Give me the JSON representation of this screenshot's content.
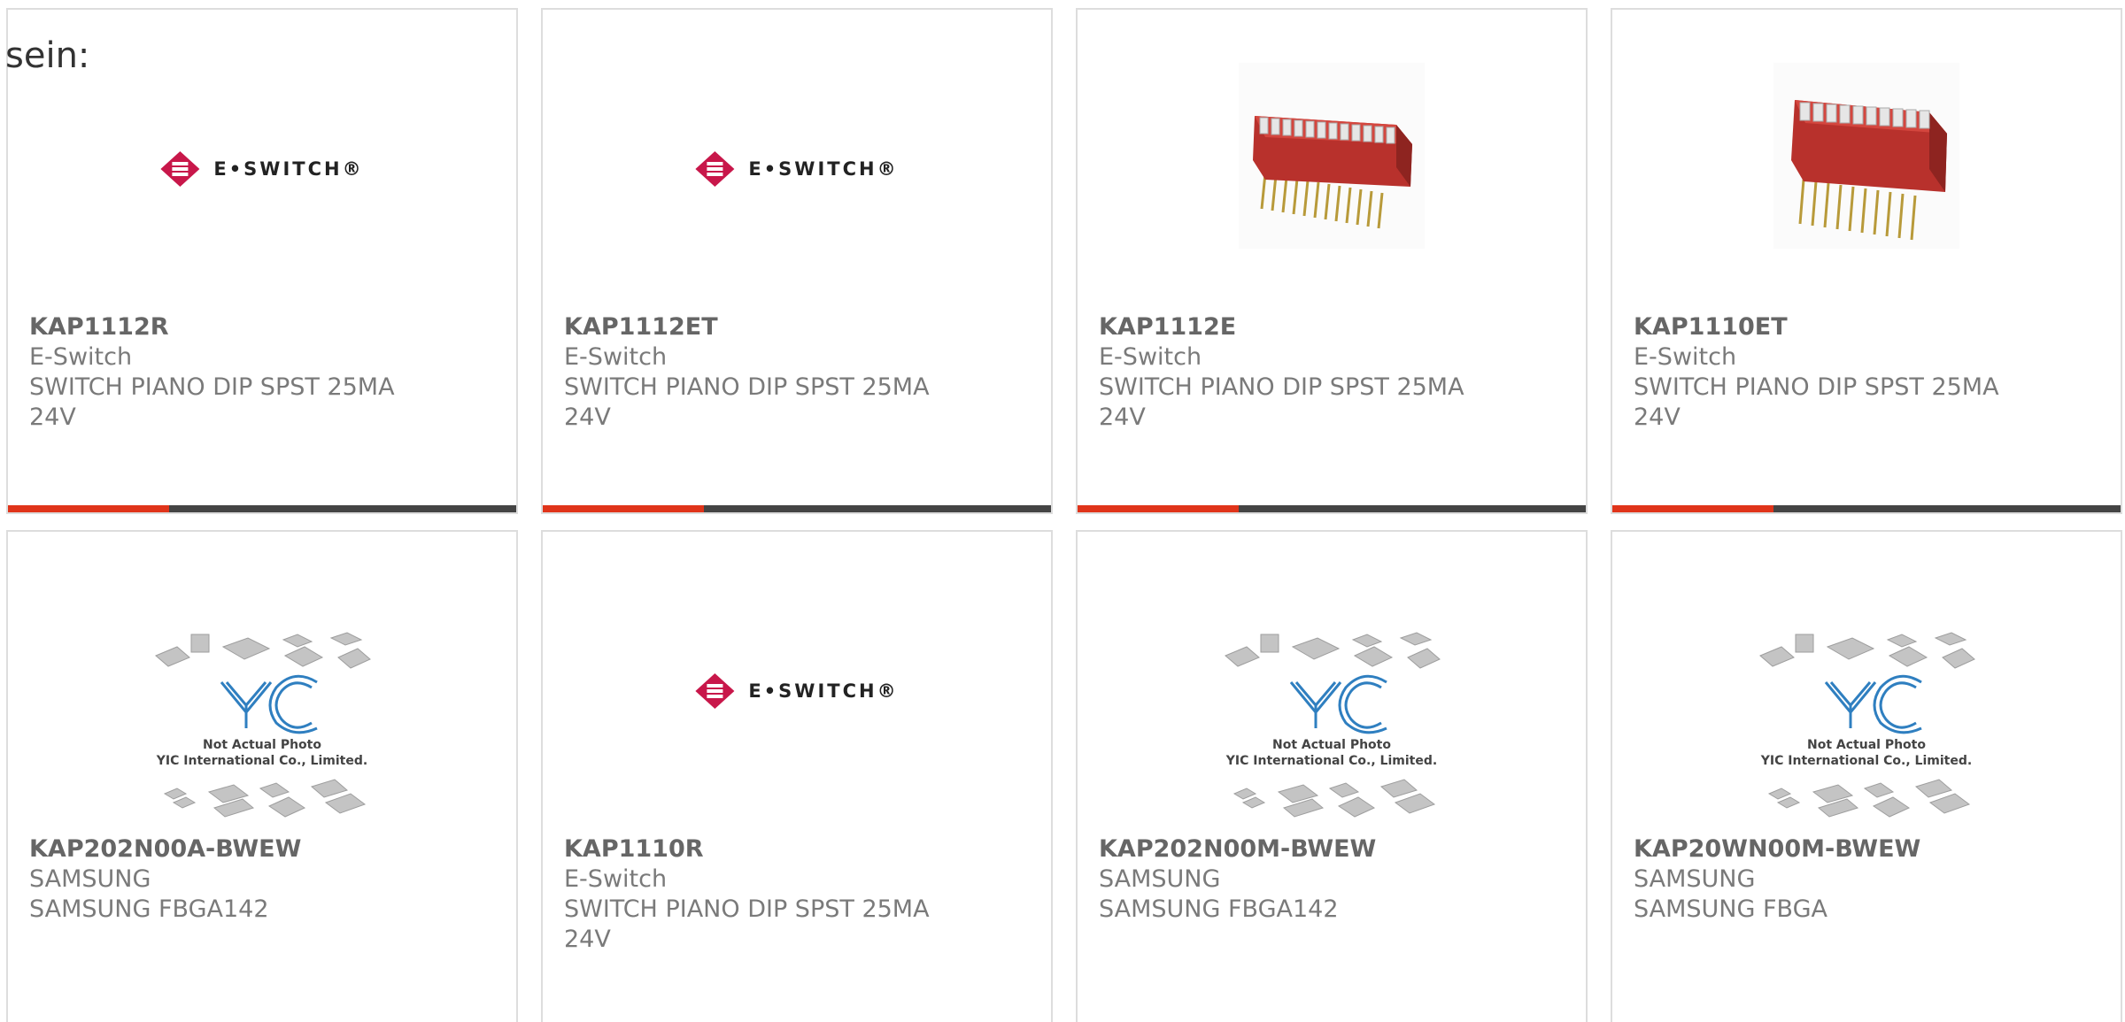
{
  "intro_text": "sein:",
  "colors": {
    "accent": "#e0341a",
    "bar": "#444444",
    "border": "#dddddd",
    "eswitch_red": "#c8174a",
    "yic_blue": "#2f7fc0"
  },
  "cards": [
    {
      "part_number": "KAP1112R",
      "manufacturer": "E-Switch",
      "desc": "SWITCH PIANO DIP SPST 25MA",
      "desc2": "24V",
      "image": "eswitch-logo",
      "logo_text": "E•SWITCH®"
    },
    {
      "part_number": "KAP1112ET",
      "manufacturer": "E-Switch",
      "desc": "SWITCH PIANO DIP SPST 25MA",
      "desc2": "24V",
      "image": "eswitch-logo",
      "logo_text": "E•SWITCH®"
    },
    {
      "part_number": "KAP1112E",
      "manufacturer": "E-Switch",
      "desc": "SWITCH PIANO DIP SPST 25MA",
      "desc2": "24V",
      "image": "dip-switch-photo-12"
    },
    {
      "part_number": "KAP1110ET",
      "manufacturer": "E-Switch",
      "desc": "SWITCH PIANO DIP SPST 25MA",
      "desc2": "24V",
      "image": "dip-switch-photo-10"
    },
    {
      "part_number": "KAP202N00A-BWEW",
      "manufacturer": "SAMSUNG",
      "desc": "SAMSUNG FBGA142",
      "desc2": "",
      "image": "yic-placeholder",
      "caption1": "Not Actual Photo",
      "caption2": "YIC International Co., Limited."
    },
    {
      "part_number": "KAP1110R",
      "manufacturer": "E-Switch",
      "desc": "SWITCH PIANO DIP SPST 25MA",
      "desc2": "24V",
      "image": "eswitch-logo",
      "logo_text": "E•SWITCH®"
    },
    {
      "part_number": "KAP202N00M-BWEW",
      "manufacturer": "SAMSUNG",
      "desc": "SAMSUNG FBGA142",
      "desc2": "",
      "image": "yic-placeholder",
      "caption1": "Not Actual Photo",
      "caption2": "YIC International Co., Limited."
    },
    {
      "part_number": "KAP20WN00M-BWEW",
      "manufacturer": "SAMSUNG",
      "desc": "SAMSUNG FBGA",
      "desc2": "",
      "image": "yic-placeholder",
      "caption1": "Not Actual Photo",
      "caption2": "YIC International Co., Limited."
    }
  ]
}
